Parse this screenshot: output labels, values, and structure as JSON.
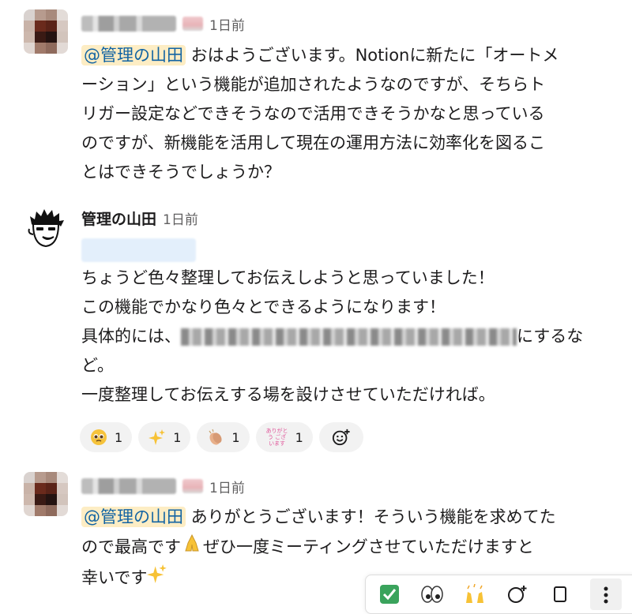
{
  "messages": [
    {
      "time": "1日前",
      "mention": "@管理の山田",
      "text1": " おはようございます。Notionに新たに「オートメ",
      "lines": [
        "ーション」という機能が追加されたようなのですが、そちらト",
        "リガー設定などできそうなので活用できそうかなと思っている",
        "のですが、新機能を活用して現在の運用方法に効率化を図るこ",
        "とはできそうでしょうか？"
      ]
    },
    {
      "sender": "管理の山田",
      "time": "1日前",
      "lines": [
        "ちょうど色々整理してお伝えしようと思っていました！",
        "この機能でかなり色々とできるようになります！"
      ],
      "detail_prefix": "具体的には、",
      "detail_suffix": "にするな",
      "detail_cont": "ど。",
      "last_line": "一度整理してお伝えする場を設けさせていただければ。",
      "reactions": [
        {
          "icon": "pleading-face-icon",
          "count": "1"
        },
        {
          "icon": "sparkles-icon",
          "count": "1"
        },
        {
          "icon": "clapping-hands-icon",
          "count": "1"
        },
        {
          "icon": "arigatou-stamp-icon",
          "label": "ありがとう ございます",
          "count": "1"
        }
      ]
    },
    {
      "time": "1日前",
      "mention": "@管理の山田",
      "text1": " ありがとうございます！そういう機能を求めてた",
      "line2a": "ので最高です",
      "line2b": "ぜひ一度ミーティングさせていただけますと",
      "line3": "幸いです"
    }
  ],
  "colors": {
    "mention_bg": "#fdedc4",
    "mention_text": "#1264a3",
    "reaction_bg": "#f2f2f2"
  }
}
